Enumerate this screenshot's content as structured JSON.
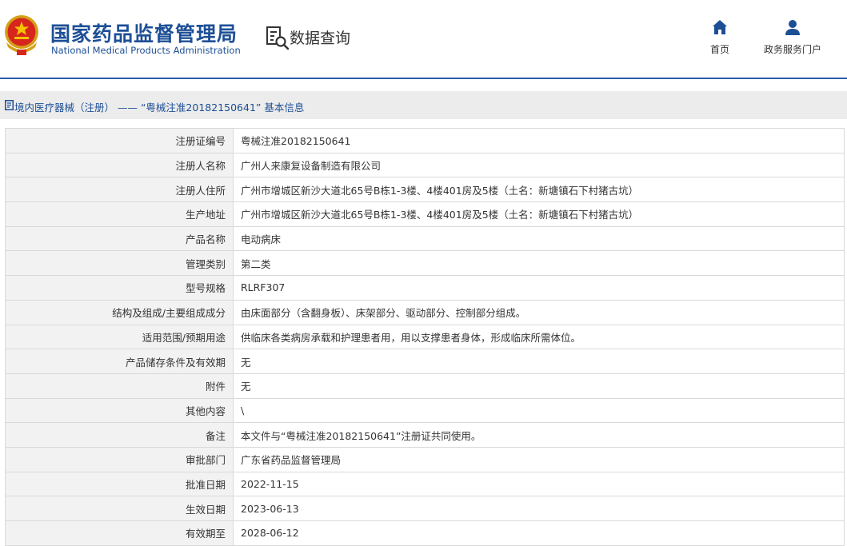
{
  "header": {
    "title_cn": "国家药品监督管理局",
    "title_en": "National Medical Products Administration",
    "query_label": "数据查询",
    "nav": [
      {
        "label": "首页",
        "icon": "home-icon"
      },
      {
        "label": "政务服务门户",
        "icon": "user-icon"
      }
    ]
  },
  "breadcrumb": {
    "text": "境内医疗器械（注册） —— “粤械注准20182150641” 基本信息",
    "icon": "document-icon"
  },
  "colors": {
    "brand_blue": "#1d4f96",
    "header_line": "#2a5ca8",
    "label_bg": "#f2f2f2",
    "breadcrumb_bg": "#ececec",
    "border": "#d9d9d9"
  },
  "rows": [
    {
      "label": "注册证编号",
      "value": "粤械注准20182150641"
    },
    {
      "label": "注册人名称",
      "value": "广州人来康复设备制造有限公司"
    },
    {
      "label": "注册人住所",
      "value": "广州市增城区新沙大道北65号B栋1-3楼、4楼401房及5楼（土名：新塘镇石下村猪古坑）"
    },
    {
      "label": "生产地址",
      "value": "广州市增城区新沙大道北65号B栋1-3楼、4楼401房及5楼（土名：新塘镇石下村猪古坑）"
    },
    {
      "label": "产品名称",
      "value": "电动病床"
    },
    {
      "label": "管理类别",
      "value": "第二类"
    },
    {
      "label": "型号规格",
      "value": "RLRF307"
    },
    {
      "label": "结构及组成/主要组成成分",
      "value": "由床面部分（含翻身板）、床架部分、驱动部分、控制部分组成。"
    },
    {
      "label": "适用范围/预期用途",
      "value": "供临床各类病房承载和护理患者用，用以支撑患者身体，形成临床所需体位。"
    },
    {
      "label": "产品储存条件及有效期",
      "value": "无"
    },
    {
      "label": "附件",
      "value": "无"
    },
    {
      "label": "其他内容",
      "value": "\\"
    },
    {
      "label": "备注",
      "value": "本文件与“粤械注准20182150641”注册证共同使用。"
    },
    {
      "label": "审批部门",
      "value": "广东省药品监督管理局"
    },
    {
      "label": "批准日期",
      "value": "2022-11-15"
    },
    {
      "label": "生效日期",
      "value": "2023-06-13"
    },
    {
      "label": "有效期至",
      "value": "2028-06-12"
    }
  ]
}
